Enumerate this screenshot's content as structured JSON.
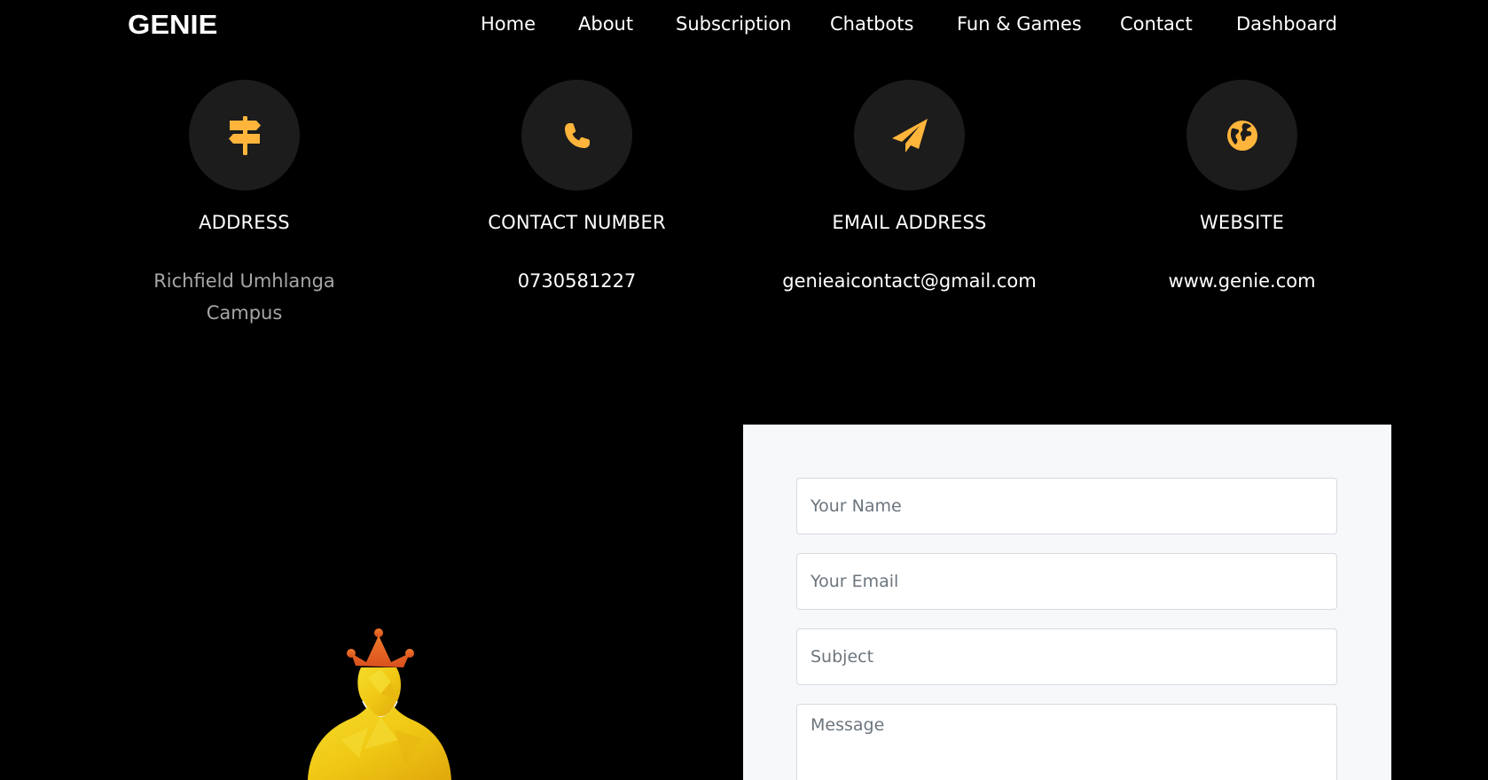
{
  "brand": "GENIE",
  "nav": {
    "items": [
      {
        "label": "Home"
      },
      {
        "label": "About"
      },
      {
        "label": "Subscription"
      },
      {
        "label": "Chatbots"
      },
      {
        "label": "Fun & Games"
      },
      {
        "label": "Contact"
      },
      {
        "label": "Dashboard"
      }
    ]
  },
  "info": {
    "address": {
      "title": "ADDRESS",
      "value": "Richfield Umhlanga Campus",
      "icon": "signpost-icon"
    },
    "phone": {
      "title": "CONTACT NUMBER",
      "value": "0730581227",
      "icon": "phone-icon"
    },
    "email": {
      "title": "EMAIL ADDRESS",
      "value": "genieaicontact@gmail.com",
      "icon": "paper-plane-icon"
    },
    "website": {
      "title": "WEBSITE",
      "value": "www.genie.com",
      "icon": "globe-icon"
    }
  },
  "form": {
    "name_placeholder": "Your Name",
    "email_placeholder": "Your Email",
    "subject_placeholder": "Subject",
    "message_placeholder": "Message"
  },
  "colors": {
    "accent": "#ffb53b",
    "background": "#000000",
    "circle": "#1c1c1c",
    "form_bg": "#f6f8fa",
    "muted_text": "#a6a6a6"
  }
}
